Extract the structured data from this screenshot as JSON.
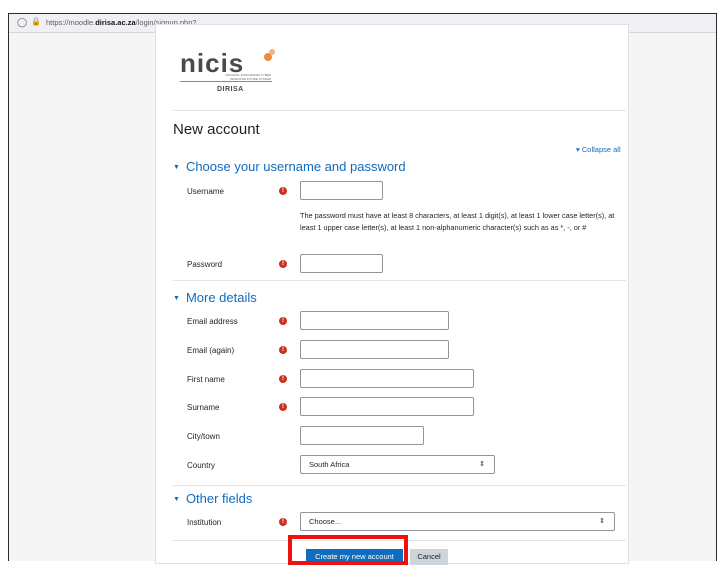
{
  "browser": {
    "url_prefix": "https://moodle.",
    "url_domain": "dirisa.ac.za",
    "url_path": "/login/signup.php?",
    "shield_icon": "shield-icon",
    "lock_icon": "lock-icon"
  },
  "logo": {
    "wordmark": "nicis",
    "tagline": "NATIONAL INTEGRATED CYBER INFRASTRUCTURE SYSTEM",
    "sub": "DIRISA"
  },
  "page": {
    "title": "New account",
    "collapse_all": "Collapse all"
  },
  "sections": {
    "credentials": "Choose your username and password",
    "more_details": "More details",
    "other_fields": "Other fields"
  },
  "fields": {
    "username_label": "Username",
    "password_hint": "The password must have at least 8 characters, at least 1 digit(s), at least 1 lower case letter(s), at least 1 upper case letter(s), at least 1 non-alphanumeric character(s) such as as *, -, or #",
    "password_label": "Password",
    "email_label": "Email address",
    "email_again_label": "Email (again)",
    "firstname_label": "First name",
    "surname_label": "Surname",
    "city_label": "City/town",
    "country_label": "Country",
    "country_value": "South Africa",
    "institution_label": "Institution",
    "institution_value": "Choose..."
  },
  "buttons": {
    "create": "Create my new account",
    "cancel": "Cancel"
  },
  "colors": {
    "link_blue": "#0f6cbf",
    "required_red": "#ca3120",
    "highlight_red": "#ee1111"
  }
}
